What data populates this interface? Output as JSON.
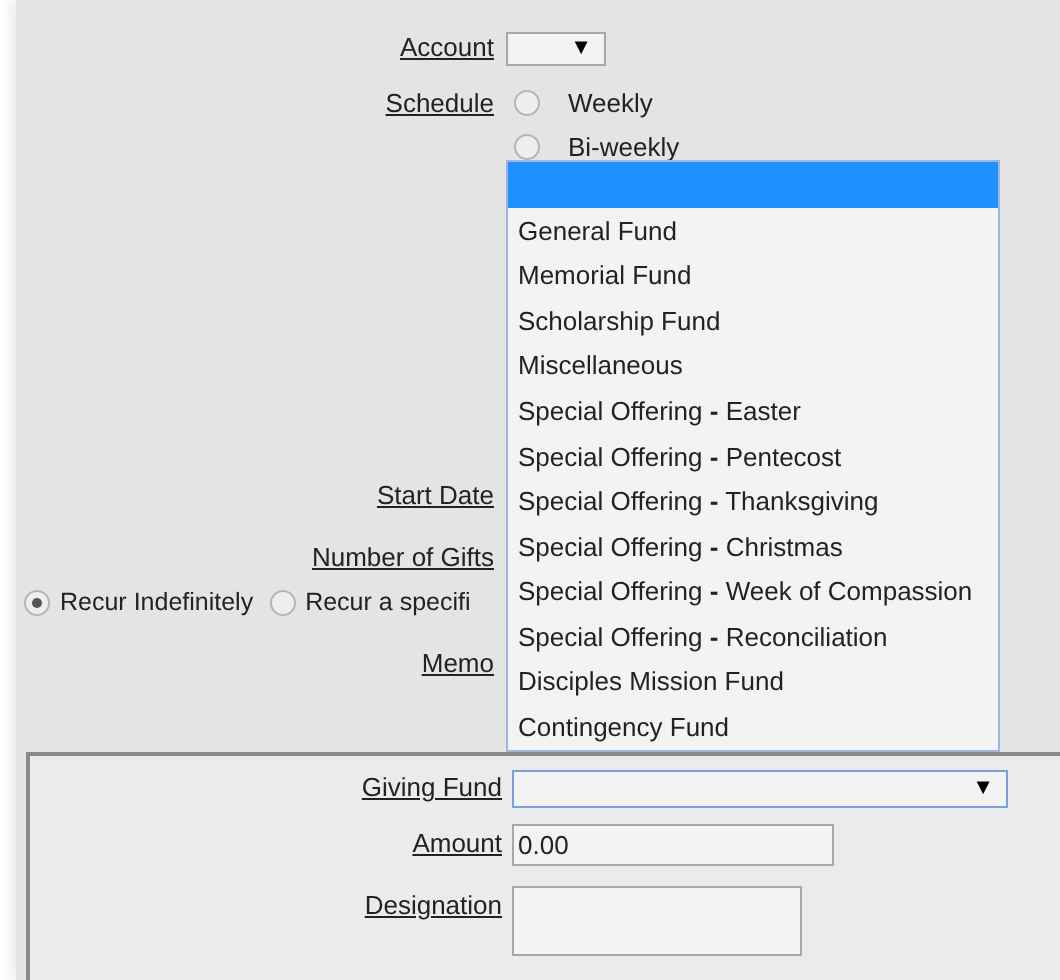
{
  "form": {
    "account": {
      "label": "Account",
      "arrow": "▼"
    },
    "schedule": {
      "label": "Schedule",
      "options": [
        {
          "label": "Weekly",
          "selected": false
        },
        {
          "label": "Bi-weekly",
          "selected": false
        }
      ]
    },
    "start_date": {
      "label": "Start Date"
    },
    "number_of_gifts": {
      "label": "Number of Gifts",
      "options": [
        {
          "label": "Recur Indefinitely",
          "selected": true
        },
        {
          "label": "Recur a specifi",
          "selected": false
        }
      ]
    },
    "memo": {
      "label": "Memo"
    }
  },
  "gift": {
    "giving_fund": {
      "label": "Giving Fund",
      "arrow": "▼",
      "expanded": true,
      "blank_option_highlighted": true,
      "options": [
        {
          "label": "General Fund"
        },
        {
          "label": "Memorial Fund"
        },
        {
          "label": "Scholarship Fund"
        },
        {
          "label": "Miscellaneous"
        },
        {
          "label": "Special Offering **-** Easter"
        },
        {
          "label": "Special Offering **-** Pentecost"
        },
        {
          "label": "Special Offering **-** Thanksgiving"
        },
        {
          "label": "Special Offering **-** Christmas"
        },
        {
          "label": "Special Offering **-** Week of Compassion"
        },
        {
          "label": "Special Offering **-** Reconciliation"
        },
        {
          "label": "Disciples Mission Fund"
        },
        {
          "label": "Contingency Fund"
        }
      ]
    },
    "amount": {
      "label": "Amount",
      "value": "0.00"
    },
    "designation": {
      "label": "Designation"
    }
  }
}
